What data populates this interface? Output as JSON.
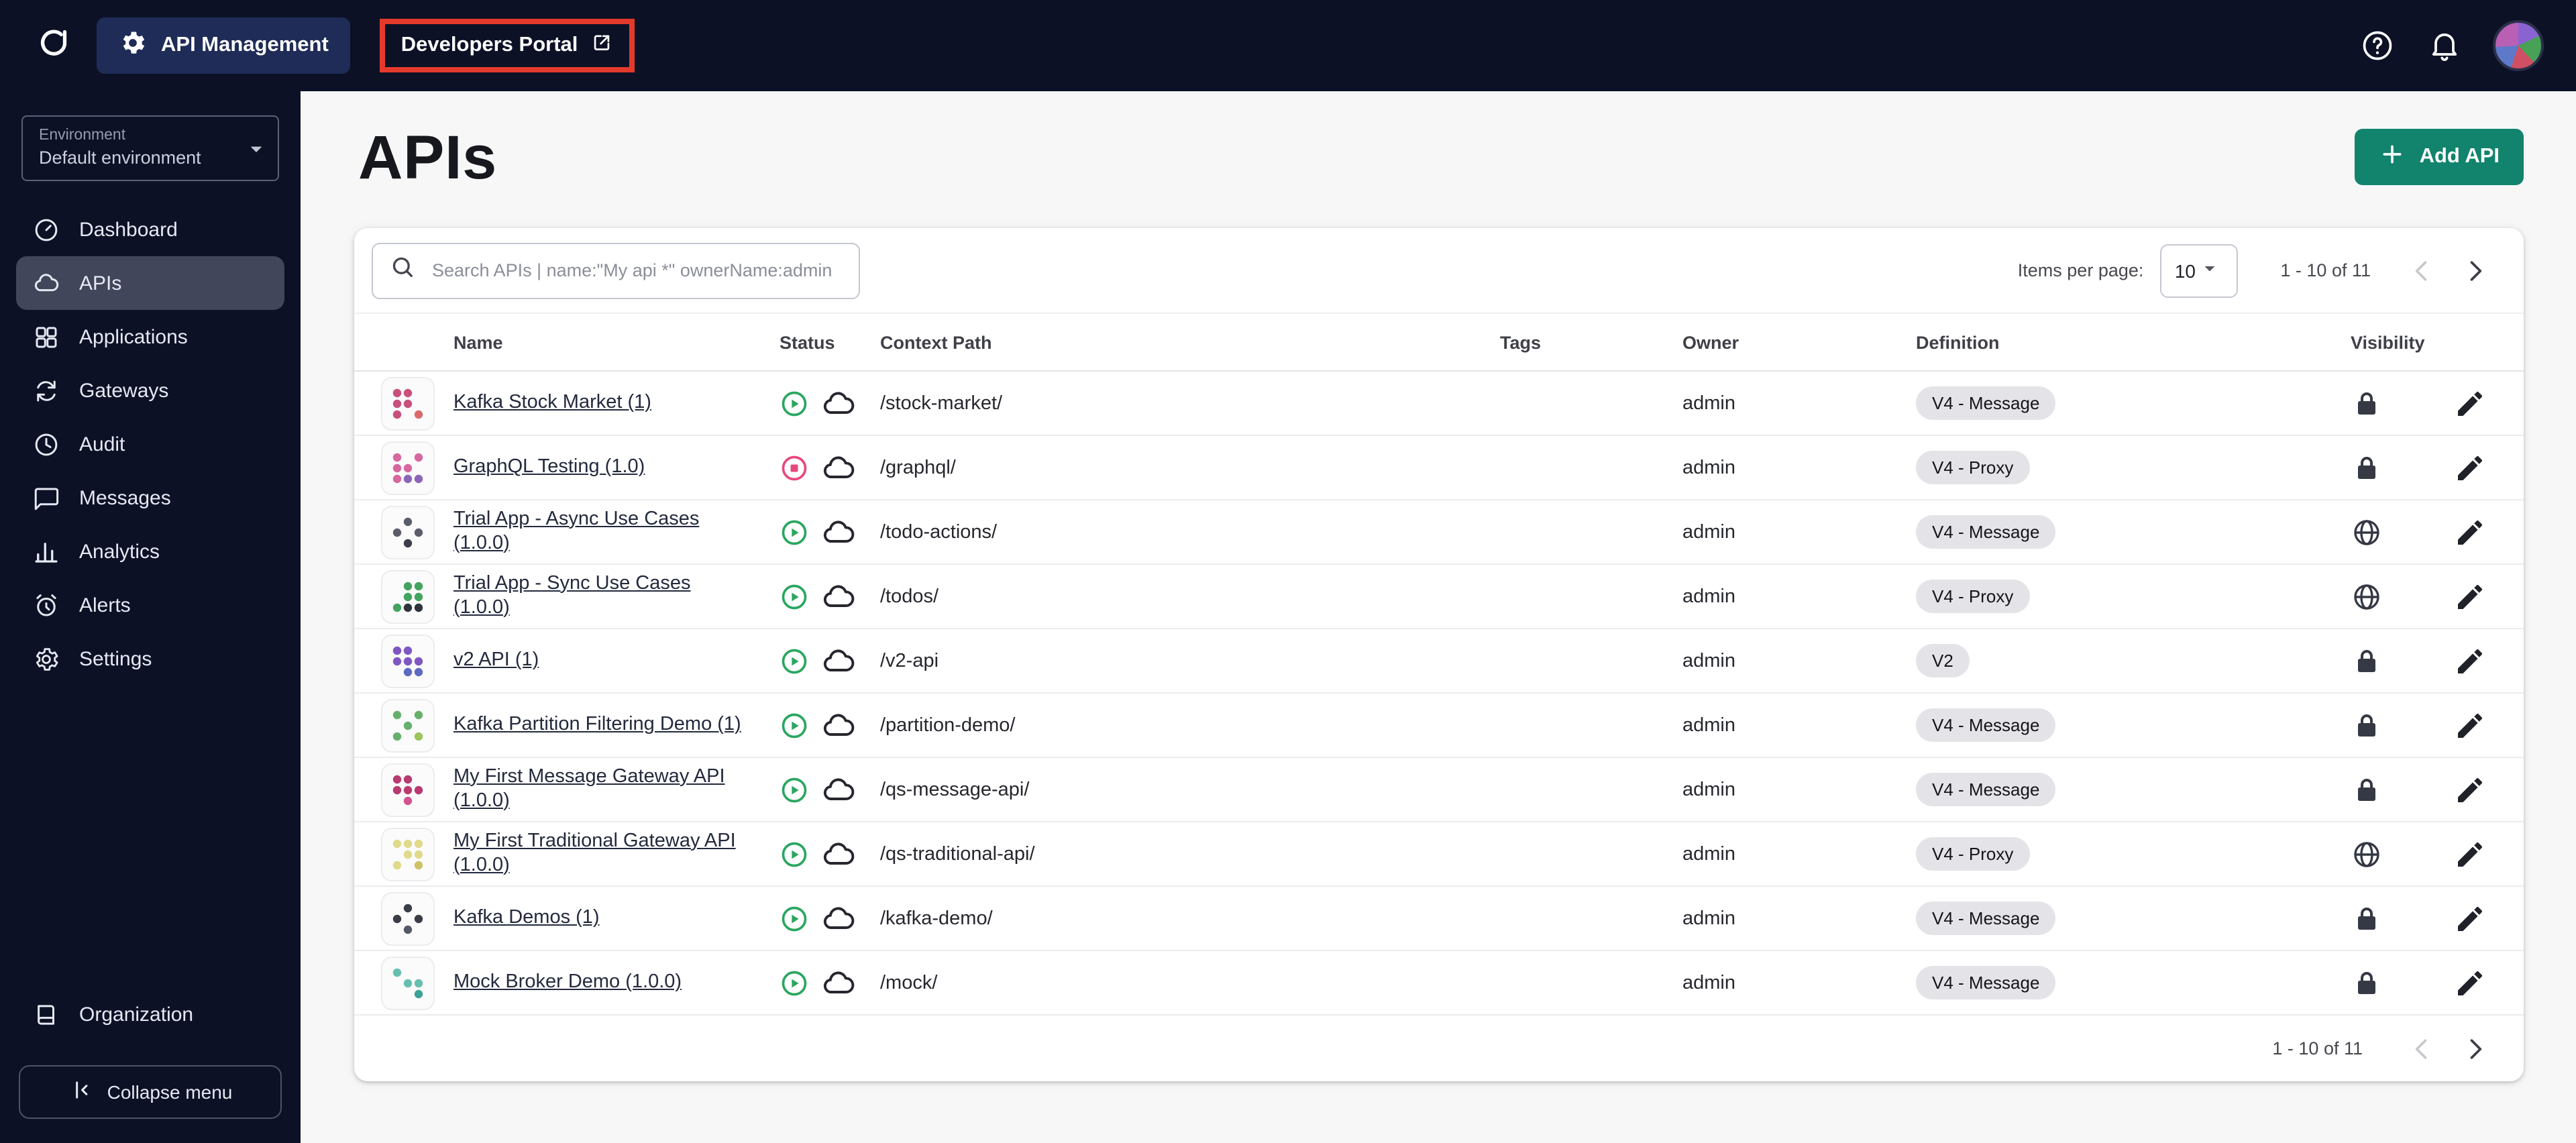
{
  "colors": {
    "accent_button": "#12836c",
    "annotation_box": "#e43a2b",
    "status_started": "#2aa660",
    "status_stopped": "#e8487c"
  },
  "topbar": {
    "app_switcher_label": "API Management",
    "portal_label": "Developers Portal"
  },
  "sidebar": {
    "environment_label": "Environment",
    "environment_value": "Default environment",
    "items": [
      {
        "label": "Dashboard",
        "icon": "dashboard",
        "active": false
      },
      {
        "label": "APIs",
        "icon": "apis",
        "active": true
      },
      {
        "label": "Applications",
        "icon": "applications",
        "active": false
      },
      {
        "label": "Gateways",
        "icon": "gateways",
        "active": false
      },
      {
        "label": "Audit",
        "icon": "audit",
        "active": false
      },
      {
        "label": "Messages",
        "icon": "messages",
        "active": false
      },
      {
        "label": "Analytics",
        "icon": "analytics",
        "active": false
      },
      {
        "label": "Alerts",
        "icon": "alerts",
        "active": false
      },
      {
        "label": "Settings",
        "icon": "settings",
        "active": false
      }
    ],
    "organization_label": "Organization",
    "collapse_label": "Collapse menu"
  },
  "main": {
    "title": "APIs",
    "add_button_label": "Add API",
    "search_placeholder": "Search APIs | name:\"My api *\" ownerName:admin",
    "items_per_page_label": "Items per page:",
    "items_per_page_value": "10",
    "range_label": "1 - 10 of 11",
    "footer_range_label": "1 - 10 of 11",
    "table": {
      "columns": [
        "Name",
        "Status",
        "Context Path",
        "Tags",
        "Owner",
        "Definition",
        "Visibility"
      ],
      "rows": [
        {
          "name": "Kafka Stock Market (1)",
          "status": "started",
          "context_path": "/stock-market/",
          "tags": "",
          "owner": "admin",
          "definition": "V4 - Message",
          "visibility": "private",
          "avatar_colors": [
            "#d96a6a",
            "#c94f7c"
          ]
        },
        {
          "name": "GraphQL Testing (1.0)",
          "status": "stopped",
          "context_path": "/graphql/",
          "tags": "",
          "owner": "admin",
          "definition": "V4 - Proxy",
          "visibility": "private",
          "avatar_colors": [
            "#d667a0",
            "#8a66b8"
          ]
        },
        {
          "name": "Trial App - Async Use Cases (1.0.0)",
          "status": "started",
          "context_path": "/todo-actions/",
          "tags": "",
          "owner": "admin",
          "definition": "V4 - Message",
          "visibility": "public",
          "avatar_colors": [
            "#3c3f49",
            "#5a5e6b"
          ]
        },
        {
          "name": "Trial App - Sync Use Cases (1.0.0)",
          "status": "started",
          "context_path": "/todos/",
          "tags": "",
          "owner": "admin",
          "definition": "V4 - Proxy",
          "visibility": "public",
          "avatar_colors": [
            "#43a35f",
            "#2f333c"
          ]
        },
        {
          "name": "v2 API (1)",
          "status": "started",
          "context_path": "/v2-api",
          "tags": "",
          "owner": "admin",
          "definition": "V2",
          "visibility": "private",
          "avatar_colors": [
            "#5c6bc0",
            "#7e57c2"
          ]
        },
        {
          "name": "Kafka Partition Filtering Demo (1)",
          "status": "started",
          "context_path": "/partition-demo/",
          "tags": "",
          "owner": "admin",
          "definition": "V4 - Message",
          "visibility": "private",
          "avatar_colors": [
            "#67b06c",
            "#9cc45f"
          ]
        },
        {
          "name": "My First Message Gateway API (1.0.0)",
          "status": "started",
          "context_path": "/qs-message-api/",
          "tags": "",
          "owner": "admin",
          "definition": "V4 - Message",
          "visibility": "private",
          "avatar_colors": [
            "#d2548e",
            "#b83a6e"
          ]
        },
        {
          "name": "My First Traditional Gateway API (1.0.0)",
          "status": "started",
          "context_path": "/qs-traditional-api/",
          "tags": "",
          "owner": "admin",
          "definition": "V4 - Proxy",
          "visibility": "public",
          "avatar_colors": [
            "#e0da8a",
            "#cdc268"
          ]
        },
        {
          "name": "Kafka Demos (1)",
          "status": "started",
          "context_path": "/kafka-demo/",
          "tags": "",
          "owner": "admin",
          "definition": "V4 - Message",
          "visibility": "private",
          "avatar_colors": [
            "#3a3d46",
            "#555965"
          ]
        },
        {
          "name": "Mock Broker Demo (1.0.0)",
          "status": "started",
          "context_path": "/mock/",
          "tags": "",
          "owner": "admin",
          "definition": "V4 - Message",
          "visibility": "private",
          "avatar_colors": [
            "#3aa395",
            "#66bfae"
          ]
        }
      ]
    }
  }
}
